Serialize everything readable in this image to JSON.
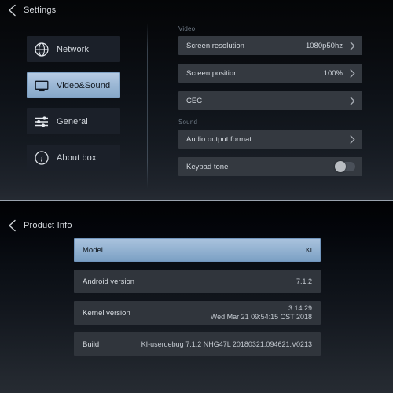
{
  "settings": {
    "title": "Settings",
    "back_icon": "back-chevron-icon",
    "sidebar": {
      "items": [
        {
          "label": "Network",
          "icon": "globe-icon",
          "selected": false
        },
        {
          "label": "Video&Sound",
          "icon": "monitor-icon",
          "selected": true
        },
        {
          "label": "General",
          "icon": "sliders-icon",
          "selected": false
        },
        {
          "label": "About box",
          "icon": "info-icon",
          "selected": false
        }
      ]
    },
    "groups": [
      {
        "label": "Video",
        "rows": [
          {
            "label": "Screen resolution",
            "value": "1080p50hz",
            "control": "chevron"
          },
          {
            "label": "Screen position",
            "value": "100%",
            "control": "chevron"
          },
          {
            "label": "CEC",
            "value": "",
            "control": "chevron"
          }
        ]
      },
      {
        "label": "Sound",
        "rows": [
          {
            "label": "Audio output format",
            "value": "",
            "control": "chevron"
          },
          {
            "label": "Keypad tone",
            "value": "",
            "control": "toggle",
            "toggle_on": false
          }
        ]
      }
    ]
  },
  "product_info": {
    "title": "Product Info",
    "back_icon": "back-chevron-icon",
    "rows": [
      {
        "label": "Model",
        "value": "KI",
        "value2": "",
        "selected": true
      },
      {
        "label": "Android version",
        "value": "7.1.2",
        "value2": "",
        "selected": false
      },
      {
        "label": "Kernel version",
        "value": "3.14.29",
        "value2": "Wed Mar 21 09:54:15 CST 2018",
        "selected": false
      },
      {
        "label": "Build",
        "value": "KI-userdebug 7.1.2 NHG47L 20180321.094621.V0213",
        "value2": "",
        "selected": false
      }
    ]
  },
  "colors": {
    "accent_selected": "#93b2d1",
    "row_background": "#343940",
    "panel_divider": "#9aa3ad",
    "text_primary": "#d4d9df",
    "text_muted": "#6f7a86"
  }
}
